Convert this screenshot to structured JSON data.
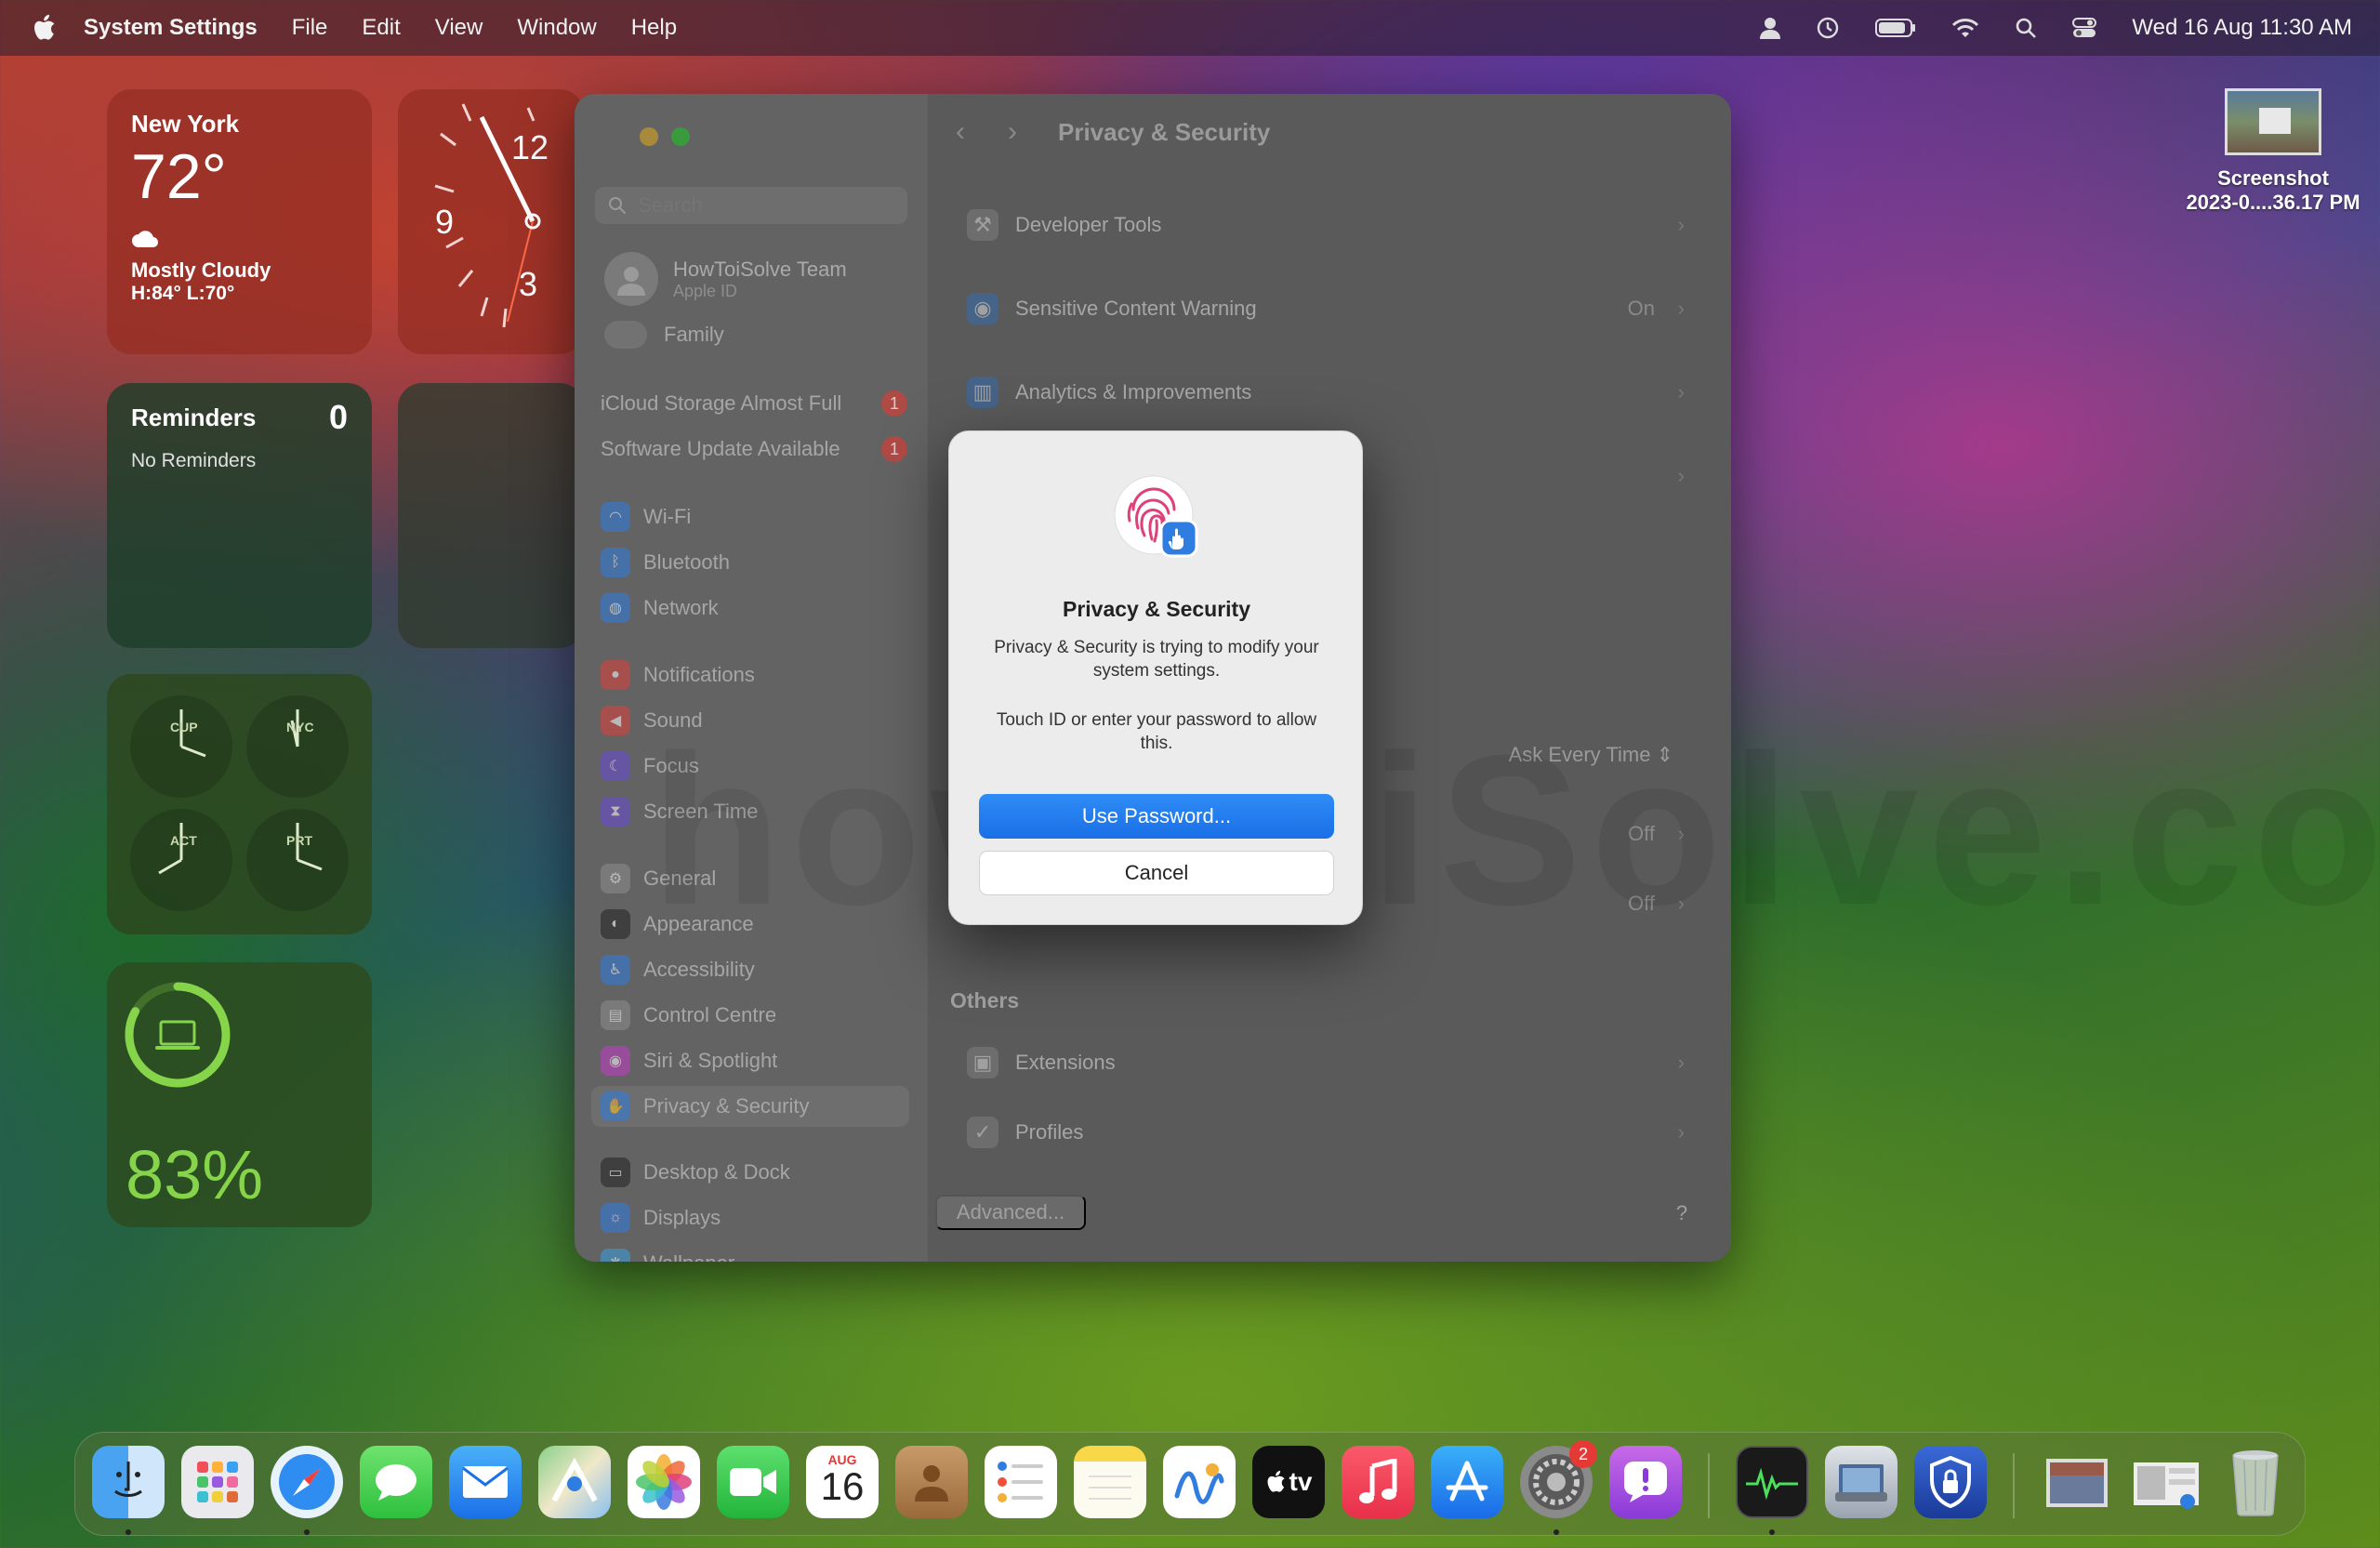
{
  "menubar": {
    "app_name": "System Settings",
    "menus": [
      "File",
      "Edit",
      "View",
      "Window",
      "Help"
    ],
    "clock": "Wed 16 Aug  11:30 AM"
  },
  "widgets": {
    "weather": {
      "city": "New York",
      "temp": "72°",
      "condition": "Mostly Cloudy",
      "hilo": "H:84° L:70°"
    },
    "clock": {
      "n12": "12",
      "n9": "9",
      "n3": "3"
    },
    "reminders": {
      "title": "Reminders",
      "count": "0",
      "empty": "No Reminders"
    },
    "world_clock": {
      "cities": [
        "CUP",
        "NYC",
        "ACT",
        "PRT"
      ]
    },
    "battery": {
      "percent": "83%",
      "level": 0.83
    }
  },
  "desktop_file": {
    "name_line1": "Screenshot",
    "name_line2": "2023-0....36.17 PM"
  },
  "window": {
    "search_placeholder": "Search",
    "account": {
      "name": "HowToiSolve Team",
      "sub": "Apple ID"
    },
    "family": "Family",
    "alerts": [
      {
        "label": "iCloud Storage Almost Full",
        "badge": "1"
      },
      {
        "label": "Software Update Available",
        "badge": "1"
      }
    ],
    "sidebar_items": [
      {
        "label": "Wi-Fi",
        "color": "#2f7de1"
      },
      {
        "label": "Bluetooth",
        "color": "#2f7de1"
      },
      {
        "label": "Network",
        "color": "#2f7de1"
      },
      {
        "label": "Notifications",
        "color": "#e0403a"
      },
      {
        "label": "Sound",
        "color": "#e0403a"
      },
      {
        "label": "Focus",
        "color": "#6a4ad8"
      },
      {
        "label": "Screen Time",
        "color": "#6a4ad8"
      },
      {
        "label": "General",
        "color": "#8e8e8e"
      },
      {
        "label": "Appearance",
        "color": "#222222"
      },
      {
        "label": "Accessibility",
        "color": "#2f7de1"
      },
      {
        "label": "Control Centre",
        "color": "#8e8e8e"
      },
      {
        "label": "Siri & Spotlight",
        "color": "#c43cc8"
      },
      {
        "label": "Privacy & Security",
        "color": "#2f7de1"
      },
      {
        "label": "Desktop & Dock",
        "color": "#222222"
      },
      {
        "label": "Displays",
        "color": "#2f7de1"
      },
      {
        "label": "Wallpaper",
        "color": "#3aa0e0"
      }
    ],
    "pane_title": "Privacy & Security",
    "rows": [
      {
        "label": "Developer Tools",
        "value": ""
      },
      {
        "label": "Sensitive Content Warning",
        "value": "On"
      },
      {
        "label": "Analytics & Improvements",
        "value": ""
      }
    ],
    "ask_value": "Ask Every Time",
    "off1": "Off",
    "off2": "Off",
    "others_title": "Others",
    "others_rows": [
      {
        "label": "Extensions"
      },
      {
        "label": "Profiles"
      }
    ],
    "advanced_label": "Advanced...",
    "help_label": "?"
  },
  "dialog": {
    "title": "Privacy & Security",
    "message": "Privacy & Security is trying to modify your system settings.",
    "message2": "Touch ID or enter your password to allow this.",
    "primary_button": "Use Password...",
    "secondary_button": "Cancel"
  },
  "dock": {
    "calendar_month": "AUG",
    "calendar_day": "16",
    "settings_badge": "2",
    "apps": [
      "finder",
      "launchpad",
      "safari",
      "messages",
      "mail",
      "maps",
      "photos",
      "facetime",
      "calendar",
      "contacts",
      "reminders",
      "notes",
      "freeform",
      "tv",
      "music",
      "app-store",
      "system-settings",
      "feedback",
      "activity-monitor",
      "preview",
      "shield",
      "stack-1",
      "stack-2",
      "trash"
    ],
    "tv_label": "tv"
  },
  "watermark": "howToiSolve.com"
}
